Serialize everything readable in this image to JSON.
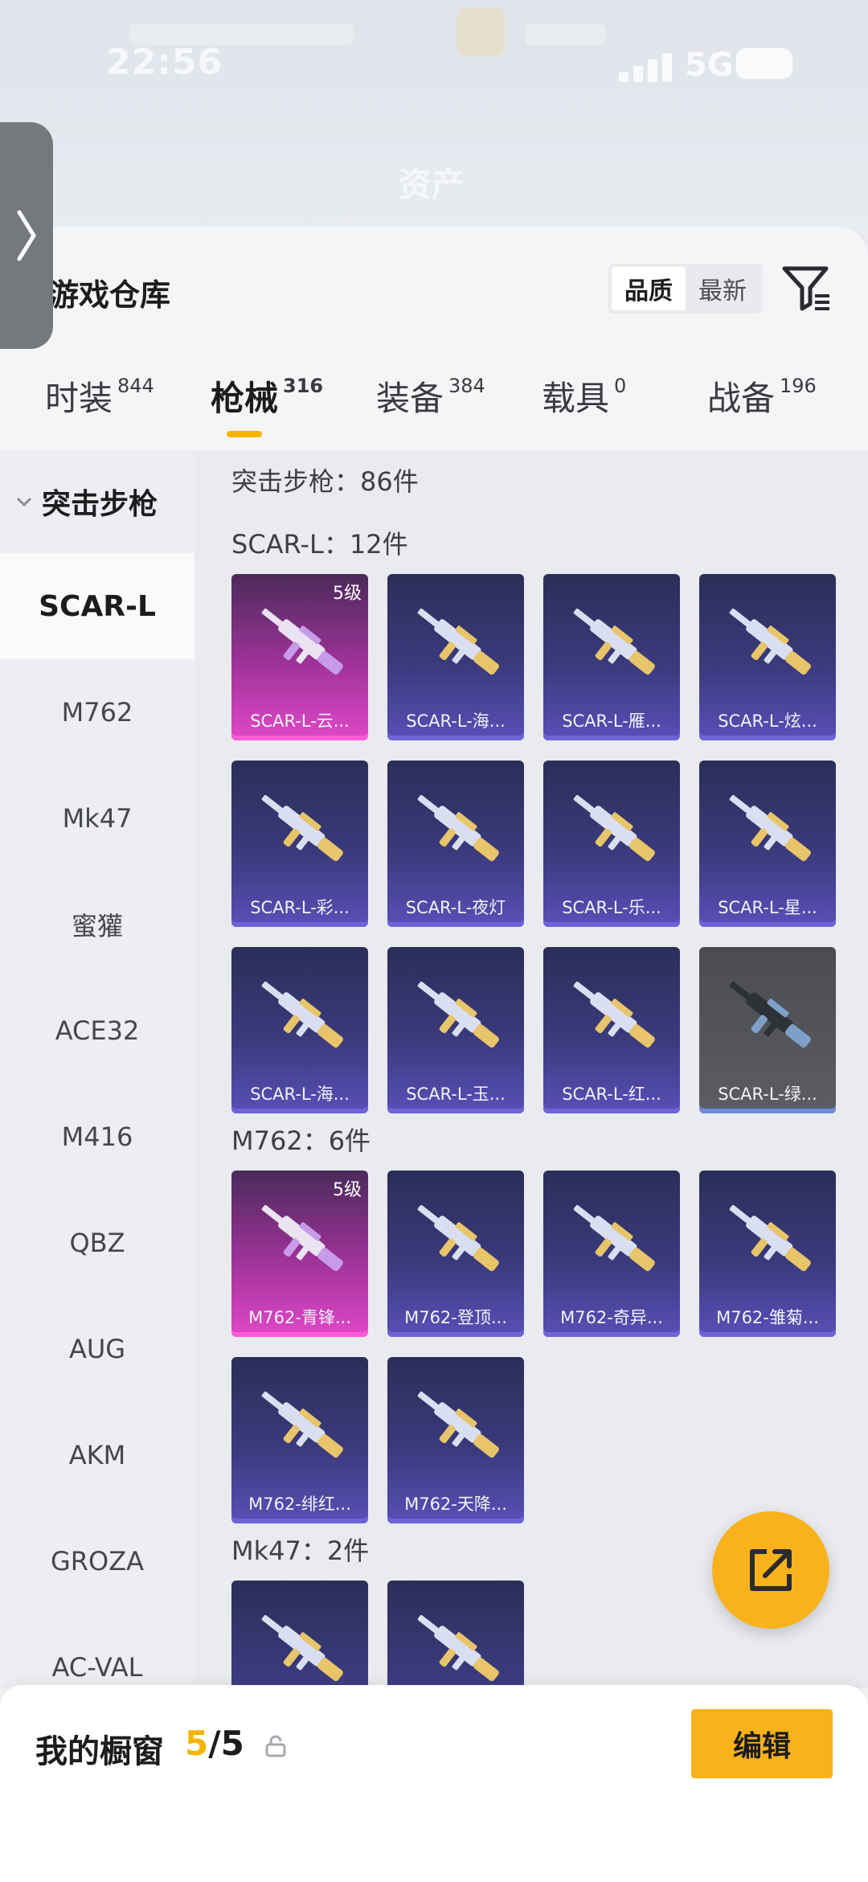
{
  "status_bar": {
    "time": "22:56",
    "network": "5G"
  },
  "background": {
    "title": "资产"
  },
  "header": {
    "title": "游戏仓库",
    "sort_options": [
      {
        "label": "品质",
        "active": true
      },
      {
        "label": "最新",
        "active": false
      }
    ],
    "filter_icon": "filter-icon"
  },
  "tabs": [
    {
      "label": "时装",
      "count": "844",
      "active": false
    },
    {
      "label": "枪械",
      "count": "316",
      "active": true
    },
    {
      "label": "装备",
      "count": "384",
      "active": false
    },
    {
      "label": "载具",
      "count": "0",
      "active": false
    },
    {
      "label": "战备",
      "count": "196",
      "active": false
    }
  ],
  "subnav": {
    "group": "突击步枪",
    "items": [
      "SCAR-L",
      "M762",
      "Mk47",
      "蜜獾",
      "ACE32",
      "M416",
      "QBZ",
      "AUG",
      "AKM",
      "GROZA",
      "AC-VAL"
    ],
    "active_index": 0
  },
  "content": {
    "category_summary": "突击步枪：86件",
    "sections": [
      {
        "title": "SCAR-L：12件",
        "cards": [
          {
            "name": "SCAR-L-云...",
            "level": "5级",
            "tier": "gold"
          },
          {
            "name": "SCAR-L-海...",
            "tier": "purple"
          },
          {
            "name": "SCAR-L-雁...",
            "tier": "purple"
          },
          {
            "name": "SCAR-L-炫...",
            "tier": "purple"
          },
          {
            "name": "SCAR-L-彩...",
            "tier": "purple"
          },
          {
            "name": "SCAR-L-夜灯",
            "tier": "purple"
          },
          {
            "name": "SCAR-L-乐...",
            "tier": "purple"
          },
          {
            "name": "SCAR-L-星...",
            "tier": "purple"
          },
          {
            "name": "SCAR-L-海...",
            "tier": "purple"
          },
          {
            "name": "SCAR-L-玉...",
            "tier": "purple"
          },
          {
            "name": "SCAR-L-红...",
            "tier": "purple"
          },
          {
            "name": "SCAR-L-绿...",
            "tier": "grey"
          }
        ]
      },
      {
        "title": "M762：6件",
        "cards": [
          {
            "name": "M762-青锋...",
            "level": "5级",
            "tier": "gold"
          },
          {
            "name": "M762-登顶...",
            "tier": "purple"
          },
          {
            "name": "M762-奇异...",
            "tier": "purple"
          },
          {
            "name": "M762-雏菊...",
            "tier": "purple"
          },
          {
            "name": "M762-绯红...",
            "tier": "purple"
          },
          {
            "name": "M762-天降...",
            "tier": "purple"
          }
        ]
      },
      {
        "title": "Mk47：2件",
        "cards": [
          {
            "name": "",
            "tier": "purple"
          },
          {
            "name": "",
            "tier": "purple"
          }
        ]
      }
    ]
  },
  "bottom_bar": {
    "label": "我的橱窗",
    "count_current": "5",
    "count_total": "/5",
    "edit_label": "编辑"
  },
  "colors": {
    "accent": "#f9b21c",
    "tab_underline": "#f5b400",
    "gold_card": "#e048c8",
    "purple_card": "#5a4fb8"
  }
}
